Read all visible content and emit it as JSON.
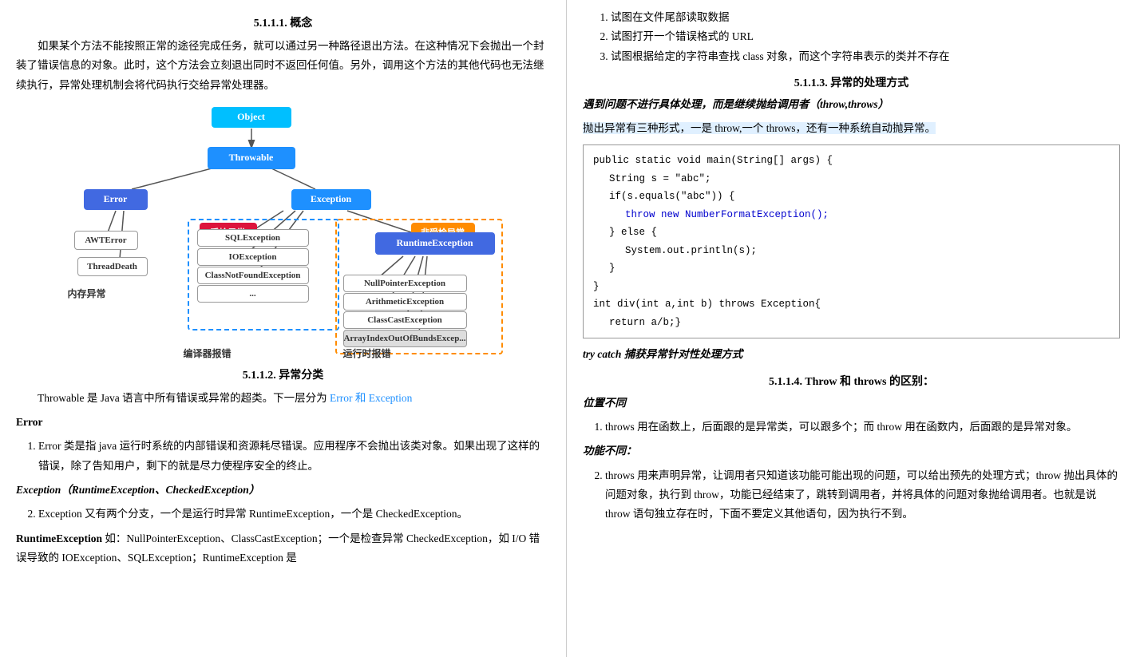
{
  "left": {
    "section111": {
      "title": "5.1.1.1.    概念",
      "para1": "如果某个方法不能按照正常的途径完成任务，就可以通过另一种路径退出方法。在这种情况下会抛出一个封装了错误信息的对象。此时，这个方法会立刻退出同时不返回任何值。另外，调用这个方法的其他代码也无法继续执行，异常处理机制会将代码执行交给异常处理器。"
    },
    "diagram": {
      "label_compiler": "编译器报错",
      "label_runtime": "运行时报错",
      "label_memory": "内存异常",
      "object": "Object",
      "throwable": "Throwable",
      "error": "Error",
      "exception": "Exception",
      "checked": "受检异常",
      "unchecked": "非受检异常",
      "awterror": "AWTError",
      "threaddeath": "ThreadDeath",
      "sqlexception": "SQLException",
      "ioexception": "IOException",
      "classnotfound": "ClassNotFoundException",
      "dots": "...",
      "runtimeexception": "RuntimeException",
      "nullpointer": "NullPointerException",
      "arithmetic": "ArithmeticException",
      "classcast": "ClassCastException",
      "arrayindex": "ArrayIndexOutOfBundsExcep..."
    },
    "section112": {
      "title": "5.1.1.2.    异常分类",
      "para1_prefix": "Throwable 是 Java 语言中所有错误或异常的超类。下一层分为 ",
      "para1_colored": "Error 和 Exception",
      "error_title": "Error",
      "error_item1": "Error 类是指 java 运行时系统的内部错误和资源耗尽错误。应用程序不会抛出该类对象。如果出现了这样的错误，除了告知用户，剩下的就是尽力使程序安全的终止。",
      "exception_title": "Exception（RuntimeException、CheckedException）",
      "exception_item1": "Exception 又有两个分支，一个是运行时异常 RuntimeException，一个是 CheckedException。",
      "runtime_bold": "RuntimeException",
      "runtime_text": " 如：NullPointerException、ClassCastException；一个是检查异常 CheckedException，如 I/O 错误导致的 IOException、SQLException；RuntimeException 是"
    }
  },
  "right": {
    "list_items": [
      "试图在文件尾部读取数据",
      "试图打开一个错误格式的 URL",
      "试图根据给定的字符串查找 class 对象，而这个字符串表示的类并不存在"
    ],
    "section113": {
      "title": "5.1.1.3.    异常的处理方式",
      "italic_bold": "遇到问题不进行具体处理，而是继续抛给调用者（throw,throws）",
      "throw_intro": "抛出异常有三种形式，一是 throw,一个 throws，还有一种系统自动抛异常。",
      "code": {
        "line1": "public static void main(String[] args) {",
        "line2": "String s = \"abc\";",
        "line3": "if(s.equals(\"abc\")) {",
        "line4": "  throw new NumberFormatException();",
        "line5": "} else {",
        "line6": "  System.out.println(s);",
        "line7": "}",
        "line8": "}",
        "line9": "int div(int a,int b) throws Exception{",
        "line10": "return a/b;}"
      },
      "trycatch_label": "try catch 捕获异常针对性处理方式"
    },
    "section114": {
      "title": "5.1.1.4.    Throw 和 throws 的区别：",
      "position_title": "位置不同",
      "position_item1": "throws 用在函数上，后面跟的是异常类，可以跟多个；而 throw 用在函数内，后面跟的是异常对象。",
      "function_title": "功能不同：",
      "function_item2_prefix": "throws 用来声明异常，让调用者只知道该功能可能出现的问题，可以给出预先的处理方式；throw 抛出具体的问题对象，执行到 throw，功能已经结束了，跳转到调用者，并将具体的问题对象抛给调用者。也就是说 throw 语句独立存在时，下面不要定义其他语句，因为执行不到。"
    }
  }
}
